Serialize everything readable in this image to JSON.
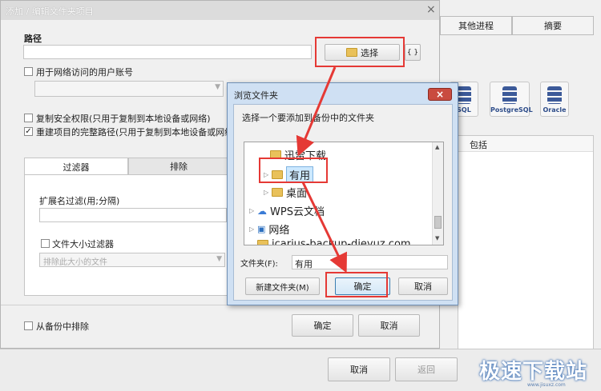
{
  "back_window": {
    "tabs": [
      "其他进程",
      "摘要"
    ],
    "db_icons": [
      "SQL",
      "PostgreSQL",
      "Oracle"
    ],
    "table_header": "包括",
    "buttons": {
      "cancel": "取消",
      "back": "返回"
    }
  },
  "main_dialog": {
    "title": "添加 / 编辑文件夹项目",
    "close_icon": "×",
    "path_label": "路径",
    "path_value": "",
    "select_button": "选择",
    "braces_button": "{ }",
    "network_user_checkbox": {
      "label": "用于网络访问的用户账号",
      "checked": false
    },
    "copy_security_checkbox": {
      "label": "复制安全权限(只用于复制到本地设备或网络)",
      "checked": false
    },
    "rebuild_path_checkbox": {
      "label": "重建项目的完整路径(只用于复制到本地设备或网络)",
      "checked": true
    },
    "tabs": {
      "filter": "过滤器",
      "exclude": "排除"
    },
    "ext_filter_label": "扩展名过滤(用;分隔)",
    "ext_filter_value": "",
    "size_filter_checkbox": {
      "label": "文件大小过滤器",
      "checked": false
    },
    "size_filter_select": "排除此大小的文件",
    "exclude_from_backup": {
      "label": "从备份中排除",
      "checked": false
    },
    "ok_button": "确定",
    "cancel_button": "取消"
  },
  "browse_dialog": {
    "title": "浏览文件夹",
    "close_icon": "×",
    "prompt": "选择一个要添加到备份中的文件夹",
    "tree": [
      {
        "label": "迅雷下载",
        "selected": false
      },
      {
        "label": "有用",
        "selected": true
      },
      {
        "label": "桌面",
        "selected": false
      },
      {
        "label": "WPS云文档",
        "selected": false
      },
      {
        "label": "网络",
        "selected": false
      },
      {
        "label": "jcarius-backup-dieyuz.com",
        "selected": false
      }
    ],
    "folder_label": "文件夹(F):",
    "folder_value": "有用",
    "new_folder_button": "新建文件夹(M)",
    "ok_button": "确定",
    "cancel_button": "取消"
  },
  "watermark": {
    "text": "极速下载站",
    "url": "www.jisuxz.com"
  },
  "colors": {
    "annotation": "#e53935",
    "selection": "#cce8ff"
  }
}
